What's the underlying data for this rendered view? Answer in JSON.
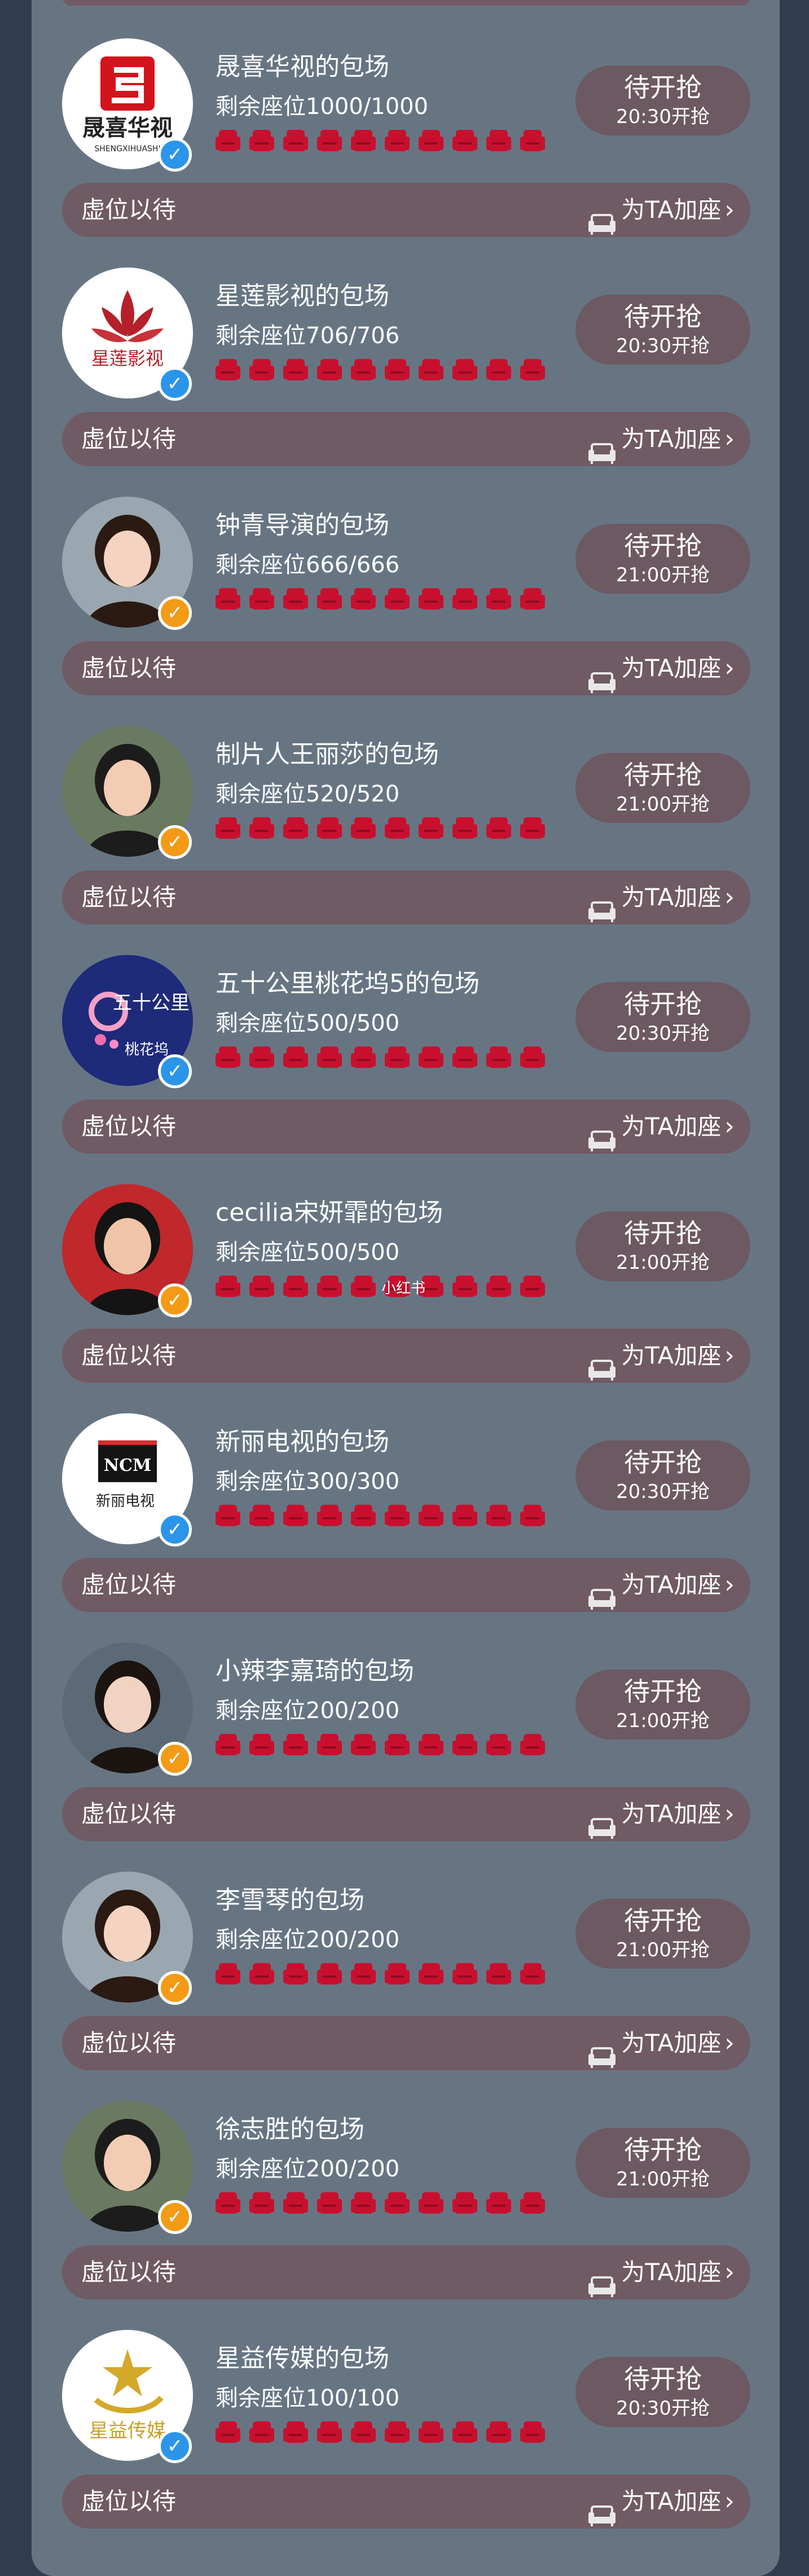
{
  "colors": {
    "page_bg": "#2f3d4f",
    "panel_bg": "#677583",
    "button_bg": "#6d5962",
    "bar_bg": "#705a63",
    "seat": "#c8102e",
    "verified_blue": "#2b95e9",
    "verified_orange": "#f39a16"
  },
  "watermark": "小红书",
  "cards": [
    {
      "title": "晟喜华视的包场",
      "seats_text": "剩余座位1000/1000",
      "button_label": "待开抢",
      "start_time": "20:30开抢",
      "vacant_label": "虚位以待",
      "add_seat_label": "为TA加座",
      "avatar_icon": "shengxi-logo-icon",
      "avatar_text": "晟喜华视",
      "avatar_subtext": "SHENGXIHUASHI",
      "verified": "blue"
    },
    {
      "title": "星莲影视的包场",
      "seats_text": "剩余座位706/706",
      "button_label": "待开抢",
      "start_time": "20:30开抢",
      "vacant_label": "虚位以待",
      "add_seat_label": "为TA加座",
      "avatar_icon": "lotus-logo-icon",
      "avatar_text": "星莲影视",
      "avatar_subtext": "",
      "verified": "blue"
    },
    {
      "title": "钟青导演的包场",
      "seats_text": "剩余座位666/666",
      "button_label": "待开抢",
      "start_time": "21:00开抢",
      "vacant_label": "虚位以待",
      "add_seat_label": "为TA加座",
      "avatar_icon": "person-photo-icon",
      "avatar_text": "",
      "avatar_subtext": "",
      "verified": "orange"
    },
    {
      "title": "制片人王丽莎的包场",
      "seats_text": "剩余座位520/520",
      "button_label": "待开抢",
      "start_time": "21:00开抢",
      "vacant_label": "虚位以待",
      "add_seat_label": "为TA加座",
      "avatar_icon": "person-photo-icon",
      "avatar_text": "",
      "avatar_subtext": "",
      "verified": "orange"
    },
    {
      "title": "五十公里桃花坞5的包场",
      "seats_text": "剩余座位500/500",
      "button_label": "待开抢",
      "start_time": "20:30开抢",
      "vacant_label": "虚位以待",
      "add_seat_label": "为TA加座",
      "avatar_icon": "taohuawu-logo-icon",
      "avatar_text": "五十公里",
      "avatar_subtext": "桃花坞",
      "verified": "blue"
    },
    {
      "title": "cecilia宋妍霏的包场",
      "seats_text": "剩余座位500/500",
      "button_label": "待开抢",
      "start_time": "21:00开抢",
      "vacant_label": "虚位以待",
      "add_seat_label": "为TA加座",
      "avatar_icon": "person-photo-icon",
      "avatar_text": "",
      "avatar_subtext": "",
      "verified": "orange"
    },
    {
      "title": "新丽电视的包场",
      "seats_text": "剩余座位300/300",
      "button_label": "待开抢",
      "start_time": "20:30开抢",
      "vacant_label": "虚位以待",
      "add_seat_label": "为TA加座",
      "avatar_icon": "ncm-logo-icon",
      "avatar_text": "NCM",
      "avatar_subtext": "新丽电视",
      "verified": "blue"
    },
    {
      "title": "小辣李嘉琦的包场",
      "seats_text": "剩余座位200/200",
      "button_label": "待开抢",
      "start_time": "21:00开抢",
      "vacant_label": "虚位以待",
      "add_seat_label": "为TA加座",
      "avatar_icon": "person-photo-icon",
      "avatar_text": "",
      "avatar_subtext": "",
      "verified": "orange"
    },
    {
      "title": "李雪琴的包场",
      "seats_text": "剩余座位200/200",
      "button_label": "待开抢",
      "start_time": "21:00开抢",
      "vacant_label": "虚位以待",
      "add_seat_label": "为TA加座",
      "avatar_icon": "person-photo-icon",
      "avatar_text": "",
      "avatar_subtext": "",
      "verified": "orange"
    },
    {
      "title": "徐志胜的包场",
      "seats_text": "剩余座位200/200",
      "button_label": "待开抢",
      "start_time": "21:00开抢",
      "vacant_label": "虚位以待",
      "add_seat_label": "为TA加座",
      "avatar_icon": "person-photo-icon",
      "avatar_text": "",
      "avatar_subtext": "",
      "verified": "orange"
    },
    {
      "title": "星益传媒的包场",
      "seats_text": "剩余座位100/100",
      "button_label": "待开抢",
      "start_time": "20:30开抢",
      "vacant_label": "虚位以待",
      "add_seat_label": "为TA加座",
      "avatar_icon": "xingyi-logo-icon",
      "avatar_text": "星益传媒",
      "avatar_subtext": "",
      "verified": "blue"
    }
  ]
}
